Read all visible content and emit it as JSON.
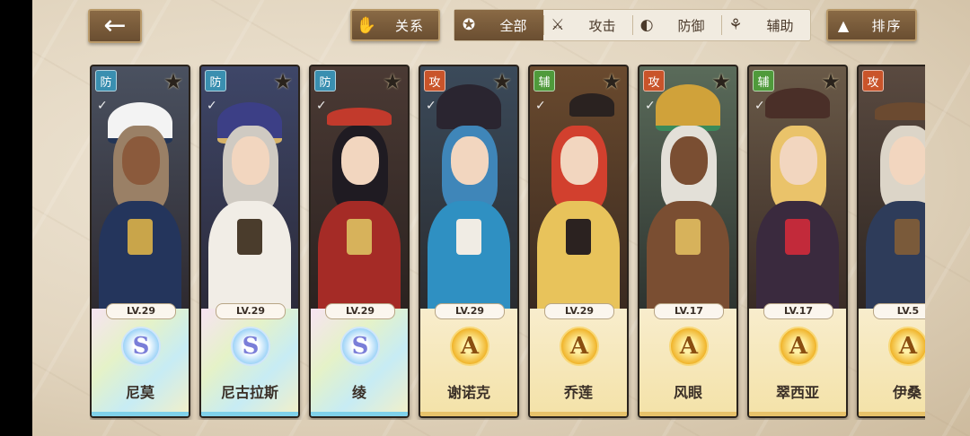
{
  "toolbar": {
    "back_icon": "arrow-left-icon",
    "relation": {
      "icon": "hand-icon",
      "label": "关系"
    },
    "filters": [
      {
        "icon": "star-circle-icon",
        "label": "全部",
        "active": true
      },
      {
        "icon": "crossed-swords-icon",
        "label": "攻击",
        "active": false
      },
      {
        "icon": "shield-icon",
        "label": "防御",
        "active": false
      },
      {
        "icon": "support-icon",
        "label": "辅助",
        "active": false
      }
    ],
    "sort": {
      "icon": "sort-arrows-icon",
      "label": "排序"
    }
  },
  "characters": [
    {
      "role": "防",
      "level": "LV.29",
      "rank": "S",
      "name": "尼莫"
    },
    {
      "role": "防",
      "level": "LV.29",
      "rank": "S",
      "name": "尼古拉斯"
    },
    {
      "role": "防",
      "level": "LV.29",
      "rank": "S",
      "name": "绫"
    },
    {
      "role": "攻",
      "level": "LV.29",
      "rank": "A",
      "name": "谢诺克"
    },
    {
      "role": "辅",
      "level": "LV.29",
      "rank": "A",
      "name": "乔莲"
    },
    {
      "role": "攻",
      "level": "LV.17",
      "rank": "A",
      "name": "风眼"
    },
    {
      "role": "辅",
      "level": "LV.17",
      "rank": "A",
      "name": "翠西亚"
    },
    {
      "role": "攻",
      "level": "LV.5",
      "rank": "A",
      "name": "伊桑"
    }
  ],
  "colors": {
    "role_defense": "#3a8fb0",
    "role_attack": "#c9542a",
    "role_support": "#4f9a3b",
    "brown_button": "#7a5b3b"
  }
}
